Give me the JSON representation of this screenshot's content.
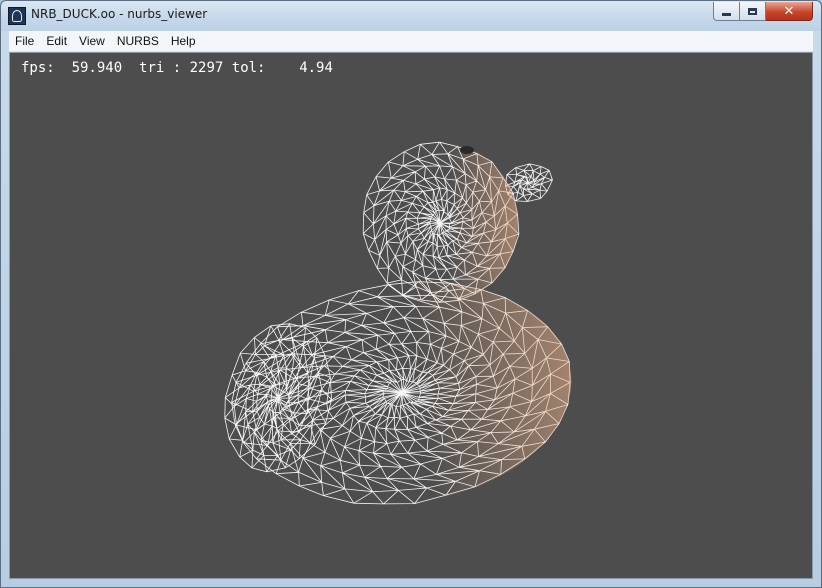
{
  "window": {
    "title": "NRB_DUCK.oo - nurbs_viewer",
    "icon": "app-icon",
    "controls": {
      "minimize_icon": "minimize-icon",
      "maximize_icon": "maximize-icon",
      "close_icon": "close-icon",
      "close_glyph": "✕"
    }
  },
  "menu": {
    "items": [
      {
        "id": "file",
        "label": "File"
      },
      {
        "id": "edit",
        "label": "Edit"
      },
      {
        "id": "view",
        "label": "View"
      },
      {
        "id": "nurbs",
        "label": "NURBS"
      },
      {
        "id": "help",
        "label": "Help"
      }
    ]
  },
  "hud": {
    "fps_label": "fps:",
    "fps_value": "59.940",
    "tri_label": "tri :",
    "tri_value": "2297",
    "tol_label": "tol:",
    "tol_value": "4.94"
  },
  "viewport": {
    "background_color": "#4d4d4d",
    "mesh_color": "#ffffff",
    "shade_color": "#e8b08a"
  }
}
